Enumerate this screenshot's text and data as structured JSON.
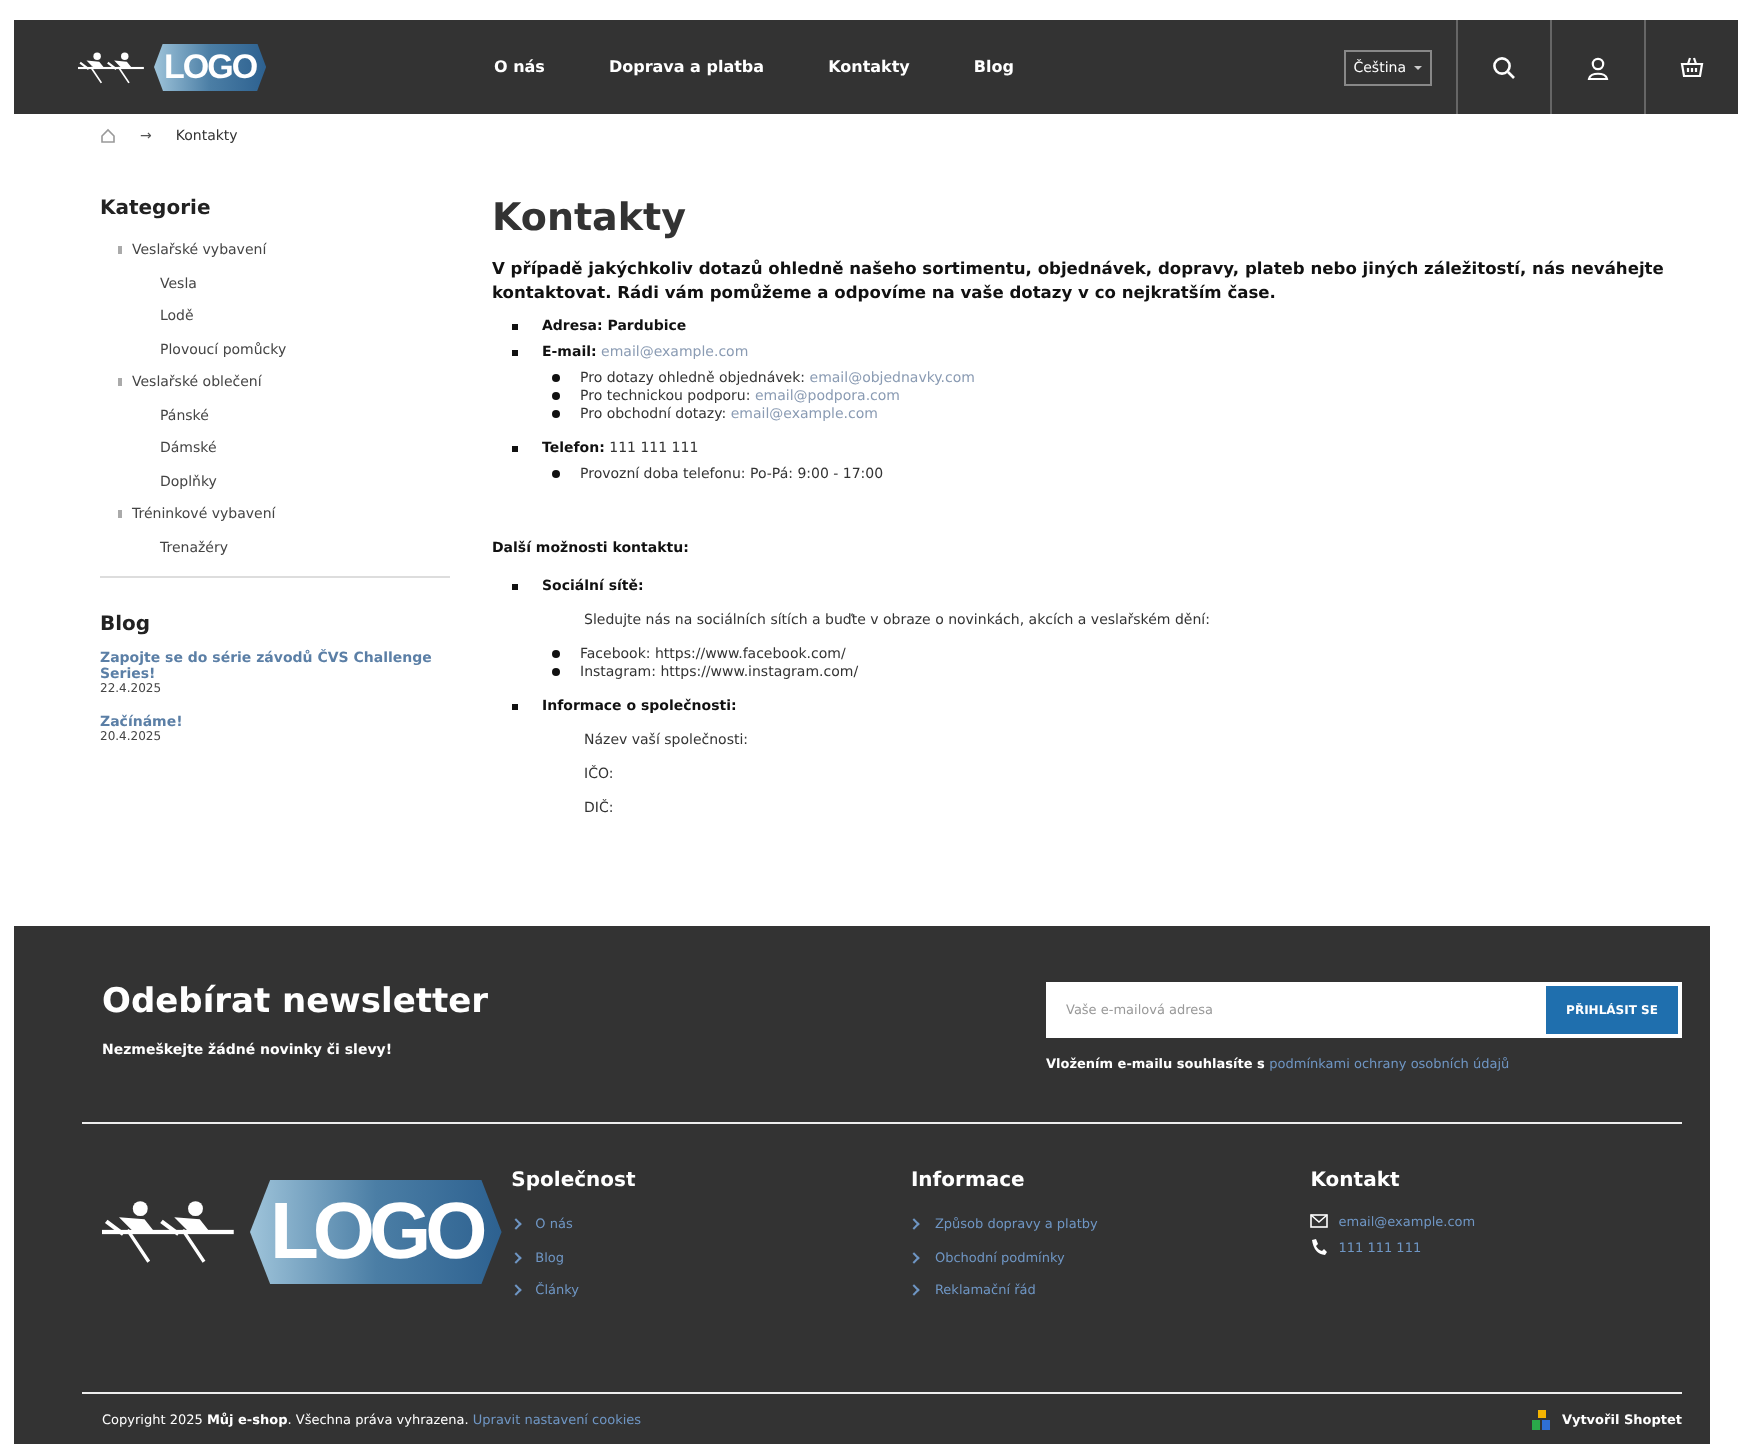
{
  "header": {
    "logo_text": "LOGO",
    "nav": [
      {
        "label": "O nás"
      },
      {
        "label": "Doprava a platba"
      },
      {
        "label": "Kontakty"
      },
      {
        "label": "Blog"
      }
    ],
    "language": "Čeština"
  },
  "breadcrumb": {
    "separator": "→",
    "current": "Kontakty"
  },
  "sidebar": {
    "title": "Kategorie",
    "categories": [
      {
        "label": "Veslařské vybavení",
        "children": [
          {
            "label": "Vesla"
          },
          {
            "label": "Lodě"
          },
          {
            "label": "Plovoucí pomůcky"
          }
        ]
      },
      {
        "label": "Veslařské oblečení",
        "children": [
          {
            "label": "Pánské"
          },
          {
            "label": "Dámské"
          },
          {
            "label": "Doplňky"
          }
        ]
      },
      {
        "label": "Tréninkové vybavení",
        "children": [
          {
            "label": "Trenažéry"
          }
        ]
      }
    ],
    "blog_title": "Blog",
    "posts": [
      {
        "title": "Zapojte se do série závodů ČVS Challenge Series!",
        "date": "22.4.2025"
      },
      {
        "title": "Začínáme!",
        "date": "20.4.2025"
      }
    ]
  },
  "content": {
    "title": "Kontakty",
    "intro": "V případě jakýchkoliv dotazů ohledně našeho sortimentu, objednávek, dopravy, plateb nebo jiných záležitostí, nás neváhejte kontaktovat. Rádi vám pomůžeme a odpovíme na vaše dotazy v co nejkratším čase.",
    "contacts": [
      {
        "label": "Adresa: Pardubice"
      },
      {
        "label": "E-mail:",
        "link": "email@example.com",
        "subitems": [
          {
            "text": "Pro dotazy ohledně objednávek:",
            "link": "email@objednavky.com"
          },
          {
            "text": "Pro technickou podporu:",
            "link": "email@podpora.com"
          },
          {
            "text": "Pro obchodní dotazy:",
            "link": "email@example.com"
          }
        ]
      },
      {
        "label": "Telefon:",
        "value": "111 111 111",
        "subitems": [
          {
            "text": "Provozní doba telefonu:  Po-Pá: 9:00 - 17:00"
          }
        ]
      }
    ],
    "more_title": "Další možnosti kontaktu:",
    "more": [
      {
        "label": "Sociální sítě:",
        "lines": [
          "Sledujte nás na sociálních sítích a buďte v obraze o novinkách, akcích a veslařském dění:"
        ],
        "subitems": [
          {
            "text": "Facebook:  https://www.facebook.com/"
          },
          {
            "text": "Instagram: https://www.instagram.com/"
          }
        ]
      },
      {
        "label": "Informace o společnosti:",
        "lines": [
          "Název vaší společnosti:",
          "IČO:",
          "DIČ:"
        ]
      }
    ]
  },
  "footer": {
    "newsletter_title": "Odebírat newsletter",
    "newsletter_text": "Nezmeškejte žádné novinky či slevy!",
    "email_placeholder": "Vaše e-mailová adresa",
    "subscribe_button": "PŘIHLÁSIT SE",
    "consent": "Vložením e-mailu souhlasíte s",
    "consent_link": "podmínkami ochrany osobních údajů",
    "logo_text": "LOGO",
    "columns": [
      {
        "title": "Společnost",
        "links": [
          "O nás",
          "Blog",
          "Články"
        ]
      },
      {
        "title": "Informace",
        "links": [
          "Způsob dopravy a platby",
          "Obchodní podmínky",
          "Reklamační řád"
        ]
      }
    ],
    "contact_title": "Kontakt",
    "contact_email": "email@example.com",
    "contact_phone": "111 111 111",
    "copyright": "Copyright 2025 **Můj e-shop**. Všechna práva vyhrazena.",
    "cookies_link": "Upravit nastavení cookies",
    "made_by": "Vytvořil Shoptet"
  }
}
